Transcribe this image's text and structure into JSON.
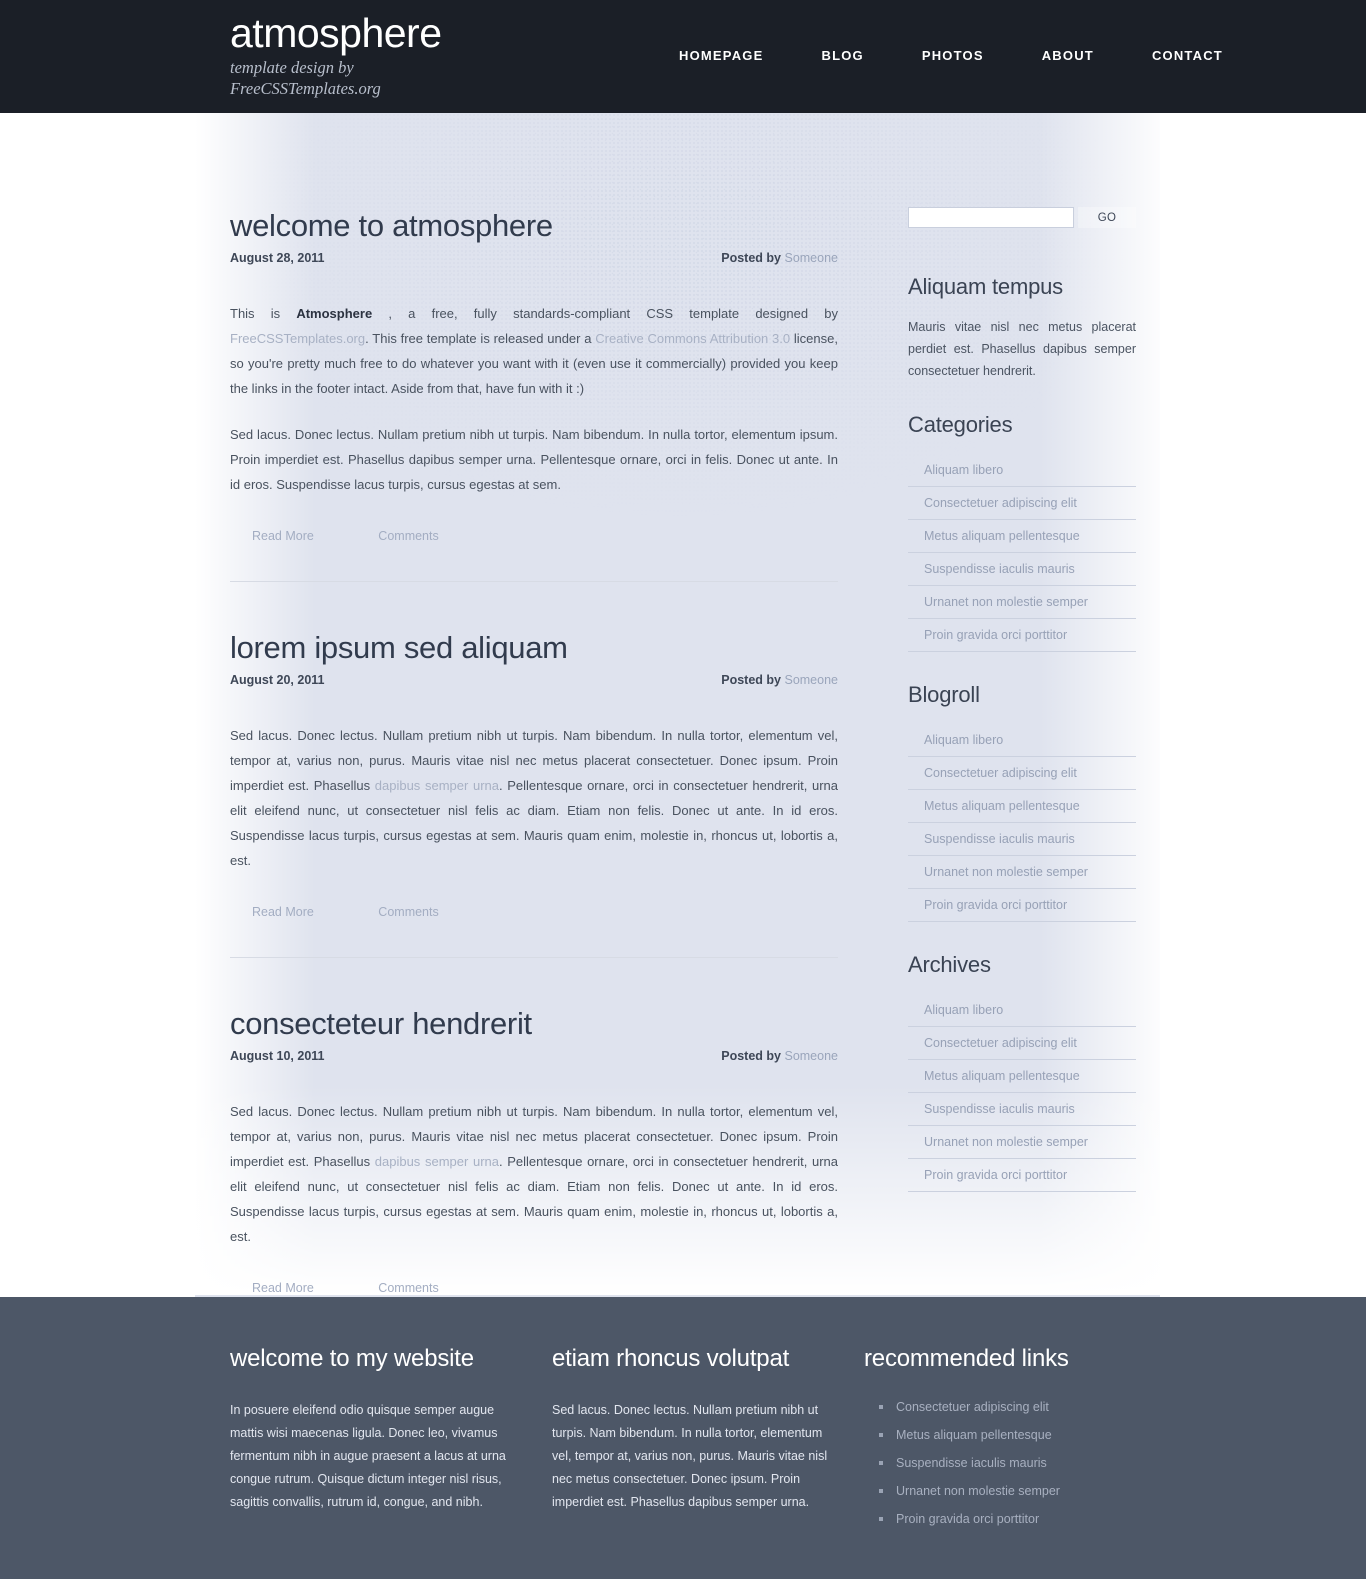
{
  "header": {
    "site_title": "atmosphere",
    "tagline_line1": "template design by",
    "tagline_line2": "FreeCSSTemplates.org",
    "nav": [
      {
        "label": "HOMEPAGE"
      },
      {
        "label": "BLOG"
      },
      {
        "label": "PHOTOS"
      },
      {
        "label": "ABOUT"
      },
      {
        "label": "CONTACT"
      }
    ]
  },
  "posts": [
    {
      "title": "welcome to atmosphere",
      "date": "August 28, 2011",
      "posted_by": "Posted by",
      "author": "Someone",
      "para1_a": "This is ",
      "para1_strong": "Atmosphere",
      "para1_b": " , a free, fully standards-compliant CSS template designed by ",
      "para1_link1": "FreeCSSTemplates.org",
      "para1_c": ". This free template is released under a ",
      "para1_link2": "Creative Commons Attribution 3.0",
      "para1_d": " license, so you're pretty much free to do whatever you want with it (even use it commercially) provided you keep the links in the footer intact. Aside from that, have fun with it :)",
      "para2": "Sed lacus. Donec lectus. Nullam pretium nibh ut turpis. Nam bibendum. In nulla tortor, elementum ipsum. Proin imperdiet est. Phasellus dapibus semper urna. Pellentesque ornare, orci in felis. Donec ut ante. In id eros. Suspendisse lacus turpis, cursus egestas at sem.",
      "read_more": "Read More",
      "comments": "Comments"
    },
    {
      "title": "lorem ipsum sed aliquam",
      "date": "August 20, 2011",
      "posted_by": "Posted by",
      "author": "Someone",
      "body_a": "Sed lacus. Donec lectus. Nullam pretium nibh ut turpis. Nam bibendum. In nulla tortor, elementum vel, tempor at, varius non, purus. Mauris vitae nisl nec metus placerat consectetuer. Donec ipsum. Proin imperdiet est. Phasellus ",
      "body_link": "dapibus semper urna",
      "body_b": ". Pellentesque ornare, orci in consectetuer hendrerit, urna elit eleifend nunc, ut consectetuer nisl felis ac diam. Etiam non felis. Donec ut ante. In id eros. Suspendisse lacus turpis, cursus egestas at sem. Mauris quam enim, molestie in, rhoncus ut, lobortis a, est.",
      "read_more": "Read More",
      "comments": "Comments"
    },
    {
      "title": "consecteteur hendrerit",
      "date": "August 10, 2011",
      "posted_by": "Posted by",
      "author": "Someone",
      "body_a": "Sed lacus. Donec lectus. Nullam pretium nibh ut turpis. Nam bibendum. In nulla tortor, elementum vel, tempor at, varius non, purus. Mauris vitae nisl nec metus placerat consectetuer. Donec ipsum. Proin imperdiet est. Phasellus ",
      "body_link": "dapibus semper urna",
      "body_b": ". Pellentesque ornare, orci in consectetuer hendrerit, urna elit eleifend nunc, ut consectetuer nisl felis ac diam. Etiam non felis. Donec ut ante. In id eros. Suspendisse lacus turpis, cursus egestas at sem. Mauris quam enim, molestie in, rhoncus ut, lobortis a, est.",
      "read_more": "Read More",
      "comments": "Comments"
    }
  ],
  "sidebar": {
    "search": {
      "value": "",
      "placeholder": "",
      "go_label": "GO"
    },
    "aliquam": {
      "title": "Aliquam tempus",
      "text": "Mauris vitae nisl nec metus placerat perdiet est. Phasellus dapibus semper consectetuer hendrerit."
    },
    "categories": {
      "title": "Categories",
      "items": [
        "Aliquam libero",
        "Consectetuer adipiscing elit",
        "Metus aliquam pellentesque",
        "Suspendisse iaculis mauris",
        "Urnanet non molestie semper",
        "Proin gravida orci porttitor"
      ]
    },
    "blogroll": {
      "title": "Blogroll",
      "items": [
        "Aliquam libero",
        "Consectetuer adipiscing elit",
        "Metus aliquam pellentesque",
        "Suspendisse iaculis mauris",
        "Urnanet non molestie semper",
        "Proin gravida orci porttitor"
      ]
    },
    "archives": {
      "title": "Archives",
      "items": [
        "Aliquam libero",
        "Consectetuer adipiscing elit",
        "Metus aliquam pellentesque",
        "Suspendisse iaculis mauris",
        "Urnanet non molestie semper",
        "Proin gravida orci porttitor"
      ]
    }
  },
  "footer": {
    "col1": {
      "title": "welcome to my website",
      "text": "In posuere eleifend odio quisque semper augue mattis wisi maecenas ligula. Donec leo, vivamus fermentum nibh in augue praesent a lacus at urna congue rutrum. Quisque dictum integer nisl risus, sagittis convallis, rutrum id, congue, and nibh."
    },
    "col2": {
      "title": "etiam rhoncus volutpat",
      "text": "Sed lacus. Donec lectus. Nullam pretium nibh ut turpis. Nam bibendum. In nulla tortor, elementum vel, tempor at, varius non, purus. Mauris vitae nisl nec metus consectetuer. Donec ipsum. Proin imperdiet est. Phasellus dapibus semper urna."
    },
    "col3": {
      "title": "recommended links",
      "items": [
        "Consectetuer adipiscing elit",
        "Metus aliquam pellentesque",
        "Suspendisse iaculis mauris",
        "Urnanet non molestie semper",
        "Proin gravida orci porttitor"
      ]
    }
  },
  "colors": {
    "header_bg": "#1b1f27",
    "cloud_bg": "#dfe3ee",
    "footer_bg": "#4d5767",
    "body_bg": "#ffffff",
    "heading": "#313b4d",
    "muted_link": "#9aa5bb"
  }
}
